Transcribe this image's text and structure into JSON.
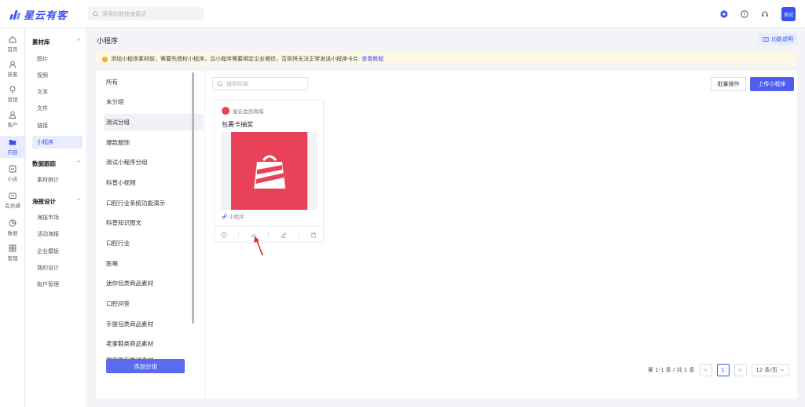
{
  "brand": {
    "name": "星云有客"
  },
  "topbar": {
    "search_placeholder": "常用功能快速直达",
    "avatar_label": "测试"
  },
  "nav": [
    {
      "label": "首页",
      "icon": "home-icon"
    },
    {
      "label": "获客",
      "icon": "user-icon"
    },
    {
      "label": "营销",
      "icon": "bulb-icon"
    },
    {
      "label": "客户",
      "icon": "customer-icon"
    },
    {
      "label": "内容",
      "icon": "folder-icon",
      "active": true
    },
    {
      "label": "小店",
      "icon": "shop-icon"
    },
    {
      "label": "会员通",
      "icon": "member-icon"
    },
    {
      "label": "数据",
      "icon": "chart-icon"
    },
    {
      "label": "管理",
      "icon": "grid-icon"
    }
  ],
  "sidebar": {
    "groups": [
      {
        "title": "素材库",
        "items": [
          "图片",
          "视频",
          "文本",
          "文件",
          "链接",
          "小程序"
        ]
      },
      {
        "title": "数据跟踪",
        "items": [
          "素材统计"
        ]
      },
      {
        "title": "海报设计",
        "items": [
          "海报市场",
          "活动海报",
          "企业模板",
          "我的设计",
          "账户管理"
        ]
      }
    ],
    "active_item": "小程序",
    "chevron": "^"
  },
  "page": {
    "title": "小程序",
    "help_label": "功能说明",
    "notice": "添加小程序素材前，需要先授权小程序，且小程序需要绑定企业微信，否则将无法正常发送小程序卡片",
    "notice_link": "查看教程"
  },
  "groups": {
    "items": [
      "所有",
      "未分组",
      "测试分组",
      "爆款服饰",
      "测试小程序分组",
      "科普小视频",
      "口腔行业系统功能演示",
      "科普知识图文",
      "口腔行业",
      "医嘱",
      "迷你包类商品素材",
      "口腔问答",
      "手提包类商品素材",
      "老爹鞋类商品素材",
      "家庭医疗推送素材"
    ],
    "active": "测试分组",
    "add_label": "添加分组"
  },
  "toolbar": {
    "search_placeholder": "搜索标题",
    "batch_label": "批量操作",
    "upload_label": "上传小程序"
  },
  "card": {
    "source": "星云会员商城",
    "title": "包裹卡抽奖",
    "type": "小程序"
  },
  "pagination": {
    "summary": "第 1-1 条 / 共 1 条",
    "prev": "<",
    "current": "1",
    "next": ">",
    "page_size": "12 条/页"
  },
  "colors": {
    "accent": "#3a52f0",
    "thumb": "#e8425a",
    "notice_bg": "#fdf8e6"
  }
}
